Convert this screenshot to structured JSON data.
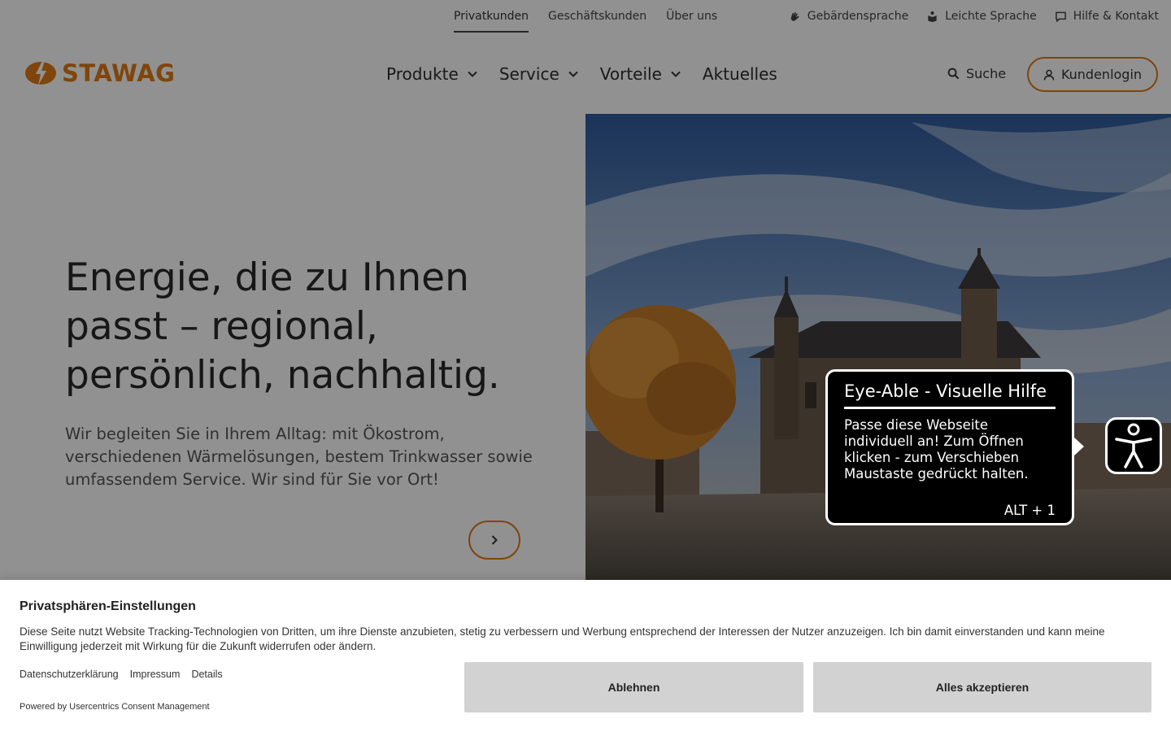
{
  "topbar": {
    "nav": [
      {
        "label": "Privatkunden",
        "active": true
      },
      {
        "label": "Geschäftskunden",
        "active": false
      },
      {
        "label": "Über uns",
        "active": false
      }
    ],
    "links": [
      {
        "label": "Gebärdensprache",
        "icon": "hand-sign-icon"
      },
      {
        "label": "Leichte Sprache",
        "icon": "easy-language-icon"
      },
      {
        "label": "Hilfe & Kontakt",
        "icon": "chat-icon"
      }
    ]
  },
  "header": {
    "logo_text": "STAWAG",
    "nav": [
      {
        "label": "Produkte",
        "has_dropdown": true
      },
      {
        "label": "Service",
        "has_dropdown": true
      },
      {
        "label": "Vorteile",
        "has_dropdown": true
      },
      {
        "label": "Aktuelles",
        "has_dropdown": false
      }
    ],
    "search_label": "Suche",
    "login_label": "Kundenlogin"
  },
  "hero": {
    "title": "Energie, die zu Ihnen passt – regional, persönlich, nachhaltig.",
    "subtitle": "Wir begleiten Sie in Ihrem Alltag: mit Ökostrom, verschiedenen Wärmelösungen, bestem Trinkwasser sowie umfassendem Service. Wir sind für Sie vor Ort!"
  },
  "eye_able": {
    "title": "Eye-Able - Visuelle Hilfe",
    "body": "Passe diese Webseite individuell an! Zum Öffnen klicken - zum Verschieben Maustaste gedrückt halten.",
    "shortcut": "ALT + 1"
  },
  "consent": {
    "title": "Privatsphären-Einstellungen",
    "text": "Diese Seite nutzt Website Tracking-Technologien von Dritten, um ihre Dienste anzubieten, stetig zu verbessern und Werbung entsprechend der Interessen der Nutzer anzuzeigen. Ich bin damit einverstanden und kann meine Einwilligung jederzeit mit Wirkung für die Zukunft widerrufen oder ändern.",
    "links": [
      "Datenschutzerklärung",
      "Impressum",
      "Details"
    ],
    "powered_by": "Powered by Usercentrics Consent Management",
    "deny_label": "Ablehnen",
    "accept_label": "Alles akzeptieren"
  },
  "colors": {
    "brand_orange": "#e07a14",
    "overlay": "rgba(0,0,0,0.43)",
    "button_gray": "#d2d2d2"
  }
}
